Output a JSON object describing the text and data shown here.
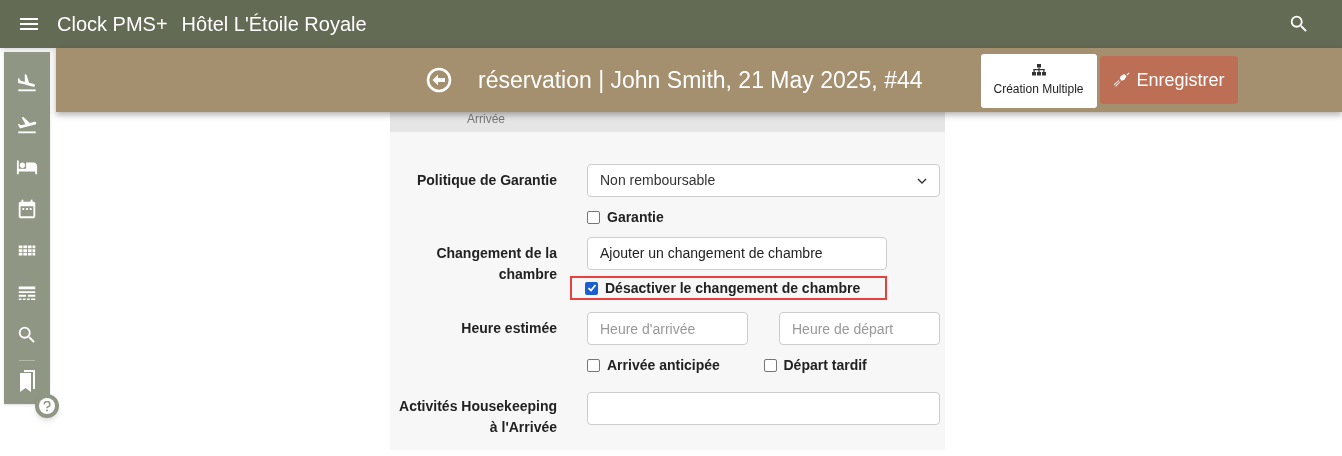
{
  "app_bar": {
    "app_name": "Clock PMS+",
    "hotel": "Hôtel L'Étoile Royale"
  },
  "banner": {
    "title": "réservation | John Smith, 21 May 2025, #44",
    "multi_button": "Création Multiple",
    "save_button": "Enregistrer"
  },
  "form": {
    "section_label": "Arrivée",
    "guarantee": {
      "label": "Politique de Garantie",
      "value": "Non remboursable",
      "checkbox": {
        "label": "Garantie",
        "checked": false
      }
    },
    "room_change": {
      "label": "Changement de la chambre",
      "button": "Ajouter un changement de chambre",
      "checkbox": {
        "label": "Désactiver le changement de chambre",
        "checked": true,
        "highlighted": true
      }
    },
    "estimated_time": {
      "label": "Heure estimée",
      "fields": [
        {
          "placeholder": "Heure d'arrivée",
          "checkbox": {
            "label": "Arrivée anticipée",
            "checked": false
          }
        },
        {
          "placeholder": "Heure de départ",
          "checkbox": {
            "label": "Départ tardif",
            "checked": false
          }
        }
      ]
    },
    "housekeeping": {
      "label": "Activités Housekeeping à l'Arrivée"
    }
  }
}
